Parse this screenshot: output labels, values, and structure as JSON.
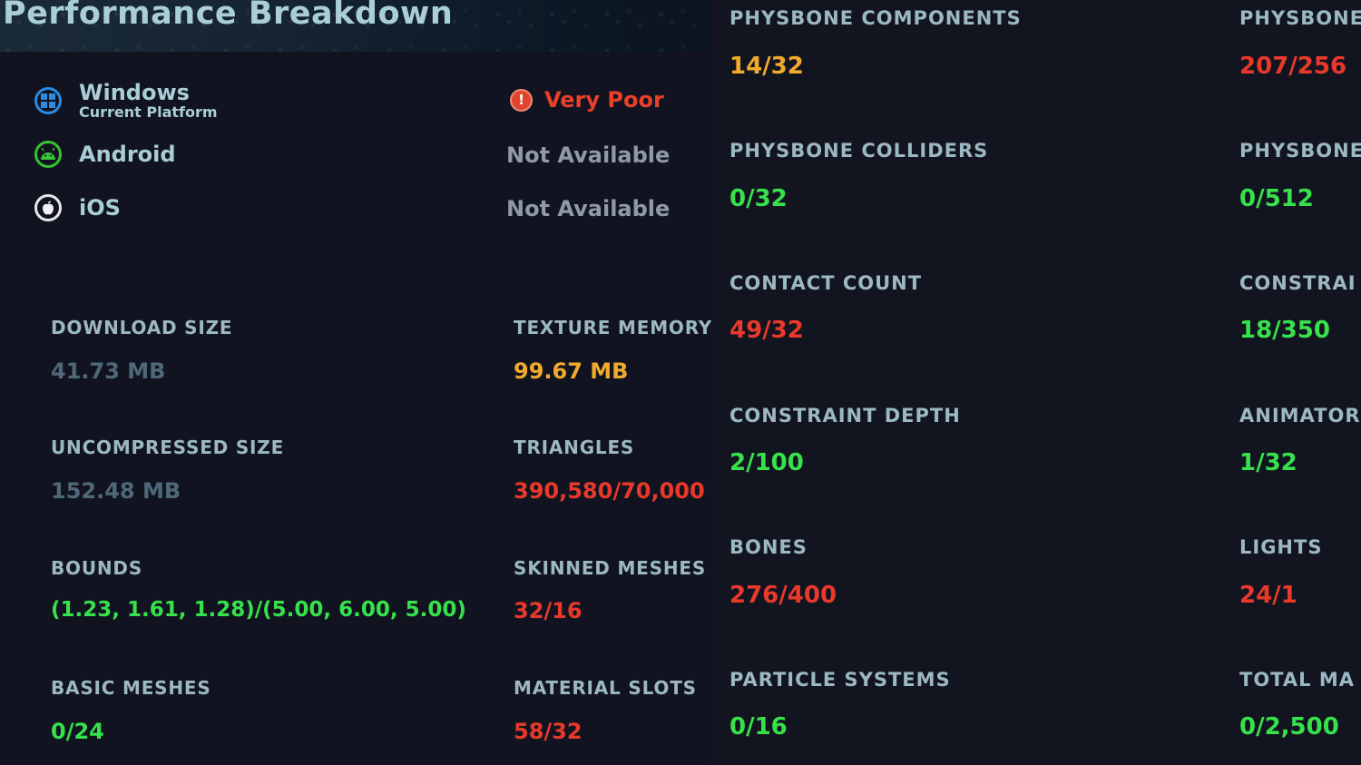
{
  "header": {
    "title": "Performance Breakdown"
  },
  "platforms": [
    {
      "name": "Windows",
      "subtitle": "Current Platform",
      "status": "Very Poor",
      "icon": "windows-icon"
    },
    {
      "name": "Android",
      "status": "Not Available",
      "icon": "android-icon"
    },
    {
      "name": "iOS",
      "status": "Not Available",
      "icon": "apple-icon"
    }
  ],
  "stats_left": [
    {
      "label": "DOWNLOAD SIZE",
      "value": "41.73 MB"
    },
    {
      "label": "UNCOMPRESSED SIZE",
      "value": "152.48 MB"
    },
    {
      "label": "BOUNDS",
      "value": "(1.23, 1.61, 1.28)/(5.00, 6.00, 5.00)"
    },
    {
      "label": "BASIC MESHES",
      "value": "0/24"
    }
  ],
  "stats_mid": [
    {
      "label": "TEXTURE MEMORY",
      "value": "99.67 MB"
    },
    {
      "label": "TRIANGLES",
      "value": "390,580/70,000"
    },
    {
      "label": "SKINNED MESHES",
      "value": "32/16"
    },
    {
      "label": "MATERIAL SLOTS",
      "value": "58/32"
    }
  ],
  "stats_right_a": [
    {
      "label": "PHYSBONE COMPONENTS",
      "value": "14/32"
    },
    {
      "label": "PHYSBONE COLLIDERS",
      "value": "0/32"
    },
    {
      "label": "CONTACT COUNT",
      "value": "49/32"
    },
    {
      "label": "CONSTRAINT DEPTH",
      "value": "2/100"
    },
    {
      "label": "BONES",
      "value": "276/400"
    },
    {
      "label": "PARTICLE SYSTEMS",
      "value": "0/16"
    }
  ],
  "stats_right_b": [
    {
      "label": "PHYSBONE",
      "value": "207/256"
    },
    {
      "label": "PHYSBONE",
      "value": "0/512"
    },
    {
      "label": "CONSTRAI",
      "value": "18/350"
    },
    {
      "label": "ANIMATOR",
      "value": "1/32"
    },
    {
      "label": "LIGHTS",
      "value": "24/1"
    },
    {
      "label": "TOTAL MA",
      "value": "0/2,500"
    }
  ],
  "colors": {
    "good": "#37e14b",
    "warning": "#f0aa2c",
    "bad": "#e8392a",
    "neutral": "#4f6878",
    "label": "#9cb8c2"
  }
}
